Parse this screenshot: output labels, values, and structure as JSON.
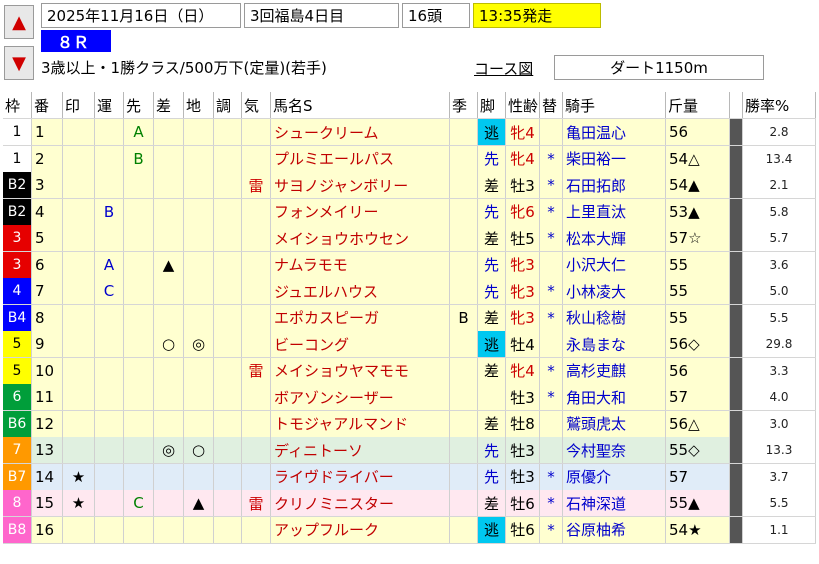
{
  "header": {
    "date": "2025年11月16日（日）",
    "meeting": "3回福島4日目",
    "heads": "16頭",
    "start_time": "13:35発走",
    "race_number": "８Ｒ",
    "conditions": "3歳以上・1勝クラス/500万下(定量)(若手)",
    "course_button": "コース図",
    "distance": "ダート1150m"
  },
  "columns": [
    "枠",
    "番",
    "印",
    "運",
    "先",
    "差",
    "地",
    "調",
    "気",
    "馬名S",
    "季",
    "脚",
    "性齢",
    "替",
    "騎手",
    "斤量",
    "",
    "勝率%"
  ],
  "colors": {
    "waku_1": "#ffffff",
    "waku_2": "#000000",
    "waku_3": "#e60000",
    "waku_4": "#0000ff",
    "waku_5": "#ffff00",
    "waku_6": "#009e3a",
    "waku_7": "#ff9900",
    "waku_8": "#ff66cc",
    "style_nige": "#00c8f0",
    "row_yellow": "#ffffd0",
    "row_pink": "#ffe8f0",
    "row_green": "#e0f0e0",
    "row_blue": "#e0ecf8"
  },
  "rows": [
    {
      "waku": "1",
      "num": "1",
      "in": "",
      "un": "",
      "sen": "A",
      "sa": "",
      "chi": "",
      "cho": "",
      "ki": "",
      "horse": "シュークリーム",
      "season": "",
      "style": "逃",
      "sexage": "牝4",
      "change": "",
      "jockey": "亀田温心",
      "weight": "56",
      "rate": "2.8"
    },
    {
      "waku": "1",
      "num": "2",
      "in": "",
      "un": "",
      "sen": "B",
      "sa": "",
      "chi": "",
      "cho": "",
      "ki": "",
      "horse": "プルミエールパス",
      "season": "",
      "style": "先",
      "sexage": "牝4",
      "change": "*",
      "jockey": "柴田裕一",
      "weight": "54△",
      "rate": "13.4"
    },
    {
      "waku": "B2",
      "num": "3",
      "in": "",
      "un": "",
      "sen": "",
      "sa": "",
      "chi": "",
      "cho": "",
      "ki": "雷",
      "horse": "サヨノジャンボリー",
      "season": "",
      "style": "差",
      "sexage": "牡3",
      "change": "*",
      "jockey": "石田拓郎",
      "weight": "54▲",
      "rate": "2.1"
    },
    {
      "waku": "B2",
      "num": "4",
      "in": "",
      "un": "B",
      "sen": "",
      "sa": "",
      "chi": "",
      "cho": "",
      "ki": "",
      "horse": "フォンメイリー",
      "season": "",
      "style": "先",
      "sexage": "牝6",
      "change": "*",
      "jockey": "上里直汰",
      "weight": "53▲",
      "rate": "5.8"
    },
    {
      "waku": "3",
      "num": "5",
      "in": "",
      "un": "",
      "sen": "",
      "sa": "",
      "chi": "",
      "cho": "",
      "ki": "",
      "horse": "メイショウホウセン",
      "season": "",
      "style": "差",
      "sexage": "牡5",
      "change": "*",
      "jockey": "松本大輝",
      "weight": "57☆",
      "rate": "5.7"
    },
    {
      "waku": "3",
      "num": "6",
      "in": "",
      "un": "A",
      "sen": "",
      "sa": "▲",
      "chi": "",
      "cho": "",
      "ki": "",
      "horse": "ナムラモモ",
      "season": "",
      "style": "先",
      "sexage": "牝3",
      "change": "",
      "jockey": "小沢大仁",
      "weight": "55",
      "rate": "3.6"
    },
    {
      "waku": "4",
      "num": "7",
      "in": "",
      "un": "C",
      "sen": "",
      "sa": "",
      "chi": "",
      "cho": "",
      "ki": "",
      "horse": "ジュエルハウス",
      "season": "",
      "style": "先",
      "sexage": "牝3",
      "change": "*",
      "jockey": "小林凌大",
      "weight": "55",
      "rate": "5.0"
    },
    {
      "waku": "B4",
      "num": "8",
      "in": "",
      "un": "",
      "sen": "",
      "sa": "",
      "chi": "",
      "cho": "",
      "ki": "",
      "horse": "エポカスピーガ",
      "season": "B",
      "style": "差",
      "sexage": "牝3",
      "change": "*",
      "jockey": "秋山稔樹",
      "weight": "55",
      "rate": "5.5"
    },
    {
      "waku": "5",
      "num": "9",
      "in": "",
      "un": "",
      "sen": "",
      "sa": "○",
      "chi": "◎",
      "cho": "",
      "ki": "",
      "horse": "ビーコング",
      "season": "",
      "style": "逃",
      "sexage": "牡4",
      "change": "",
      "jockey": "永島まな",
      "weight": "56◇",
      "rate": "29.8"
    },
    {
      "waku": "5",
      "num": "10",
      "in": "",
      "un": "",
      "sen": "",
      "sa": "",
      "chi": "",
      "cho": "",
      "ki": "雷",
      "horse": "メイショウヤマモモ",
      "season": "",
      "style": "差",
      "sexage": "牝4",
      "change": "*",
      "jockey": "高杉吏麒",
      "weight": "56",
      "rate": "3.3"
    },
    {
      "waku": "6",
      "num": "11",
      "in": "",
      "un": "",
      "sen": "",
      "sa": "",
      "chi": "",
      "cho": "",
      "ki": "",
      "horse": "ボアゾンシーザー",
      "season": "",
      "style": "",
      "sexage": "牡3",
      "change": "*",
      "jockey": "角田大和",
      "weight": "57",
      "rate": "4.0"
    },
    {
      "waku": "B6",
      "num": "12",
      "in": "",
      "un": "",
      "sen": "",
      "sa": "",
      "chi": "",
      "cho": "",
      "ki": "",
      "horse": "トモジャアルマンド",
      "season": "",
      "style": "差",
      "sexage": "牡8",
      "change": "",
      "jockey": "鷲頭虎太",
      "weight": "56△",
      "rate": "3.0"
    },
    {
      "waku": "7",
      "num": "13",
      "in": "",
      "un": "",
      "sen": "",
      "sa": "◎",
      "chi": "○",
      "cho": "",
      "ki": "",
      "horse": "ディニトーソ",
      "season": "",
      "style": "先",
      "sexage": "牡3",
      "change": "",
      "jockey": "今村聖奈",
      "weight": "55◇",
      "rate": "13.3"
    },
    {
      "waku": "B7",
      "num": "14",
      "in": "★",
      "un": "",
      "sen": "",
      "sa": "",
      "chi": "",
      "cho": "",
      "ki": "",
      "horse": "ライヴドライバー",
      "season": "",
      "style": "先",
      "sexage": "牡3",
      "change": "*",
      "jockey": "原優介",
      "weight": "57",
      "rate": "3.7"
    },
    {
      "waku": "8",
      "num": "15",
      "in": "★",
      "un": "",
      "sen": "C",
      "sa": "",
      "chi": "▲",
      "cho": "",
      "ki": "雷",
      "horse": "クリノミニスター",
      "season": "",
      "style": "差",
      "sexage": "牡6",
      "change": "*",
      "jockey": "石神深道",
      "weight": "55▲",
      "rate": "5.5"
    },
    {
      "waku": "B8",
      "num": "16",
      "in": "",
      "un": "",
      "sen": "",
      "sa": "",
      "chi": "",
      "cho": "",
      "ki": "",
      "horse": "アップフルーク",
      "season": "",
      "style": "逃",
      "sexage": "牡6",
      "change": "*",
      "jockey": "谷原柚希",
      "weight": "54★",
      "rate": "1.1"
    }
  ]
}
